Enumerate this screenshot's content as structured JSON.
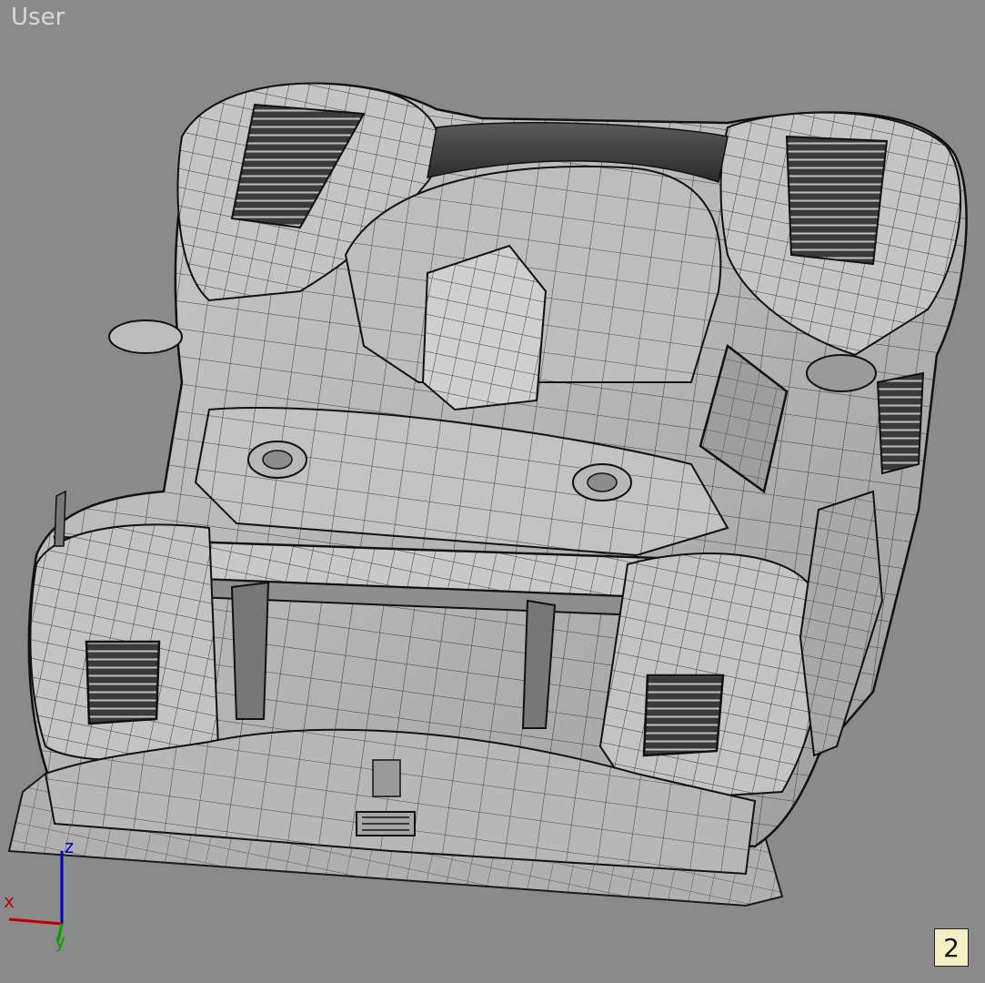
{
  "viewport": {
    "label": "User",
    "background_color": "#8a8a8a",
    "model_name_icon": "car-wireframe-model"
  },
  "axis_gizmo": {
    "x_label": "x",
    "y_label": "y",
    "z_label": "z",
    "x_color": "#c00000",
    "y_color": "#00a000",
    "z_color": "#0000c0"
  },
  "badge": {
    "text": "2"
  }
}
